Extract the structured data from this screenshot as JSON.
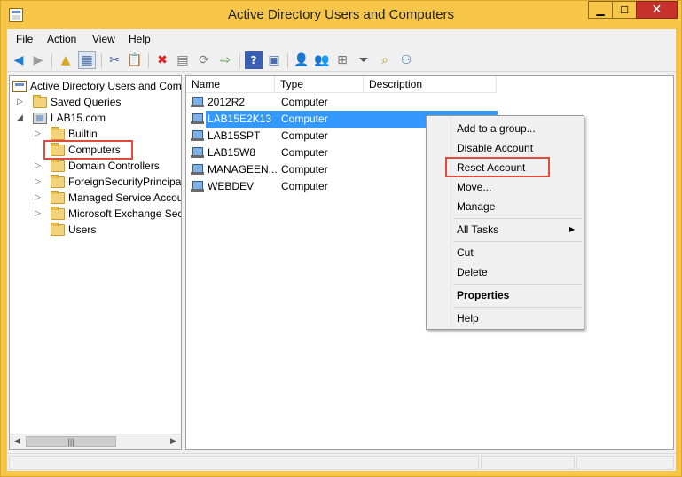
{
  "window": {
    "title": "Active Directory Users and Computers"
  },
  "menubar": {
    "items": [
      "File",
      "Action",
      "View",
      "Help"
    ]
  },
  "tree": {
    "items": [
      {
        "label": "Active Directory Users and Com",
        "level": 0
      },
      {
        "label": "Saved Queries",
        "level": 1,
        "expander": "▷"
      },
      {
        "label": "LAB15.com",
        "level": 1,
        "expander": "◢"
      },
      {
        "label": "Builtin",
        "level": 2,
        "expander": "▷"
      },
      {
        "label": "Computers",
        "level": 2,
        "expander": "",
        "selected": true
      },
      {
        "label": "Domain Controllers",
        "level": 2,
        "expander": "▷"
      },
      {
        "label": "ForeignSecurityPrincipals",
        "level": 2,
        "expander": "▷"
      },
      {
        "label": "Managed Service Accour",
        "level": 2,
        "expander": "▷"
      },
      {
        "label": "Microsoft Exchange Secu",
        "level": 2,
        "expander": "▷"
      },
      {
        "label": "Users",
        "level": 2,
        "expander": ""
      }
    ]
  },
  "list": {
    "columns": [
      "Name",
      "Type",
      "Description"
    ],
    "rows": [
      {
        "name": "2012R2",
        "type": "Computer",
        "description": ""
      },
      {
        "name": "LAB15E2K13",
        "type": "Computer",
        "description": "",
        "selected": true
      },
      {
        "name": "LAB15SPT",
        "type": "Computer",
        "description": ""
      },
      {
        "name": "LAB15W8",
        "type": "Computer",
        "description": ""
      },
      {
        "name": "MANAGEEN...",
        "type": "Computer",
        "description": ""
      },
      {
        "name": "WEBDEV",
        "type": "Computer",
        "description": ""
      }
    ]
  },
  "context_menu": {
    "items": [
      {
        "label": "Add to a group..."
      },
      {
        "label": "Disable Account"
      },
      {
        "label": "Reset Account",
        "highlighted": true
      },
      {
        "label": "Move..."
      },
      {
        "label": "Manage"
      },
      {
        "label": "All Tasks",
        "submenu": true
      },
      {
        "label": "Cut"
      },
      {
        "label": "Delete"
      },
      {
        "label": "Properties",
        "bold": true
      },
      {
        "label": "Help"
      }
    ]
  },
  "accent_colors": {
    "title_bar": "#f7c648",
    "selection": "#3399ff",
    "highlight_box": "#e24a3b",
    "close_button": "#c7312b"
  }
}
